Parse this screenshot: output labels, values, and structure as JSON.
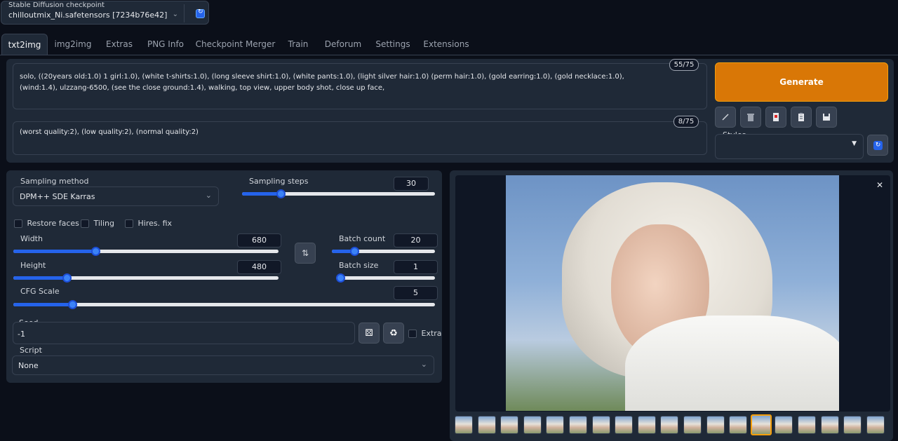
{
  "checkpoint": {
    "label": "Stable Diffusion checkpoint",
    "value": "chilloutmix_Ni.safetensors [7234b76e42]"
  },
  "tabs": [
    {
      "label": "txt2img"
    },
    {
      "label": "img2img"
    },
    {
      "label": "Extras"
    },
    {
      "label": "PNG Info"
    },
    {
      "label": "Checkpoint Merger"
    },
    {
      "label": "Train"
    },
    {
      "label": "Deforum"
    },
    {
      "label": "Settings"
    },
    {
      "label": "Extensions"
    }
  ],
  "prompt": {
    "text": "solo, ((20years old:1.0) 1 girl:1.0), (white t-shirts:1.0), (long sleeve shirt:1.0), (white pants:1.0), (light silver hair:1.0) (perm hair:1.0), (gold earring:1.0), (gold necklace:1.0), (wind:1.4),  ulzzang-6500, (see the close ground:1.4), walking, top view,  upper body shot, close up face,",
    "counter": "55/75"
  },
  "negative_prompt": {
    "text": "(worst quality:2), (low quality:2), (normal quality:2)",
    "counter": "8/75"
  },
  "generate_label": "Generate",
  "styles_label": "Styles",
  "sampling": {
    "method_label": "Sampling method",
    "method_value": "DPM++ SDE Karras",
    "steps_label": "Sampling steps",
    "steps_value": "30",
    "steps_fraction": 0.2
  },
  "options": {
    "restore_faces": "Restore faces",
    "tiling": "Tiling",
    "hires": "Hires. fix"
  },
  "width": {
    "label": "Width",
    "value": "680",
    "fraction": 0.31
  },
  "height": {
    "label": "Height",
    "value": "480",
    "fraction": 0.2
  },
  "batch_count": {
    "label": "Batch count",
    "value": "20",
    "fraction": 0.22
  },
  "batch_size": {
    "label": "Batch size",
    "value": "1",
    "fraction": 0.0
  },
  "cfg": {
    "label": "CFG Scale",
    "value": "5",
    "fraction": 0.14
  },
  "seed": {
    "label": "Seed",
    "value": "-1",
    "extra_label": "Extra"
  },
  "script": {
    "label": "Script",
    "value": "None"
  },
  "colors": {
    "generate": "#d97706",
    "accent": "#2563eb",
    "bg": "#0b0f19",
    "panel": "#1f2937"
  },
  "gallery": {
    "thumbnail_count": 19,
    "selected_index": 13
  }
}
